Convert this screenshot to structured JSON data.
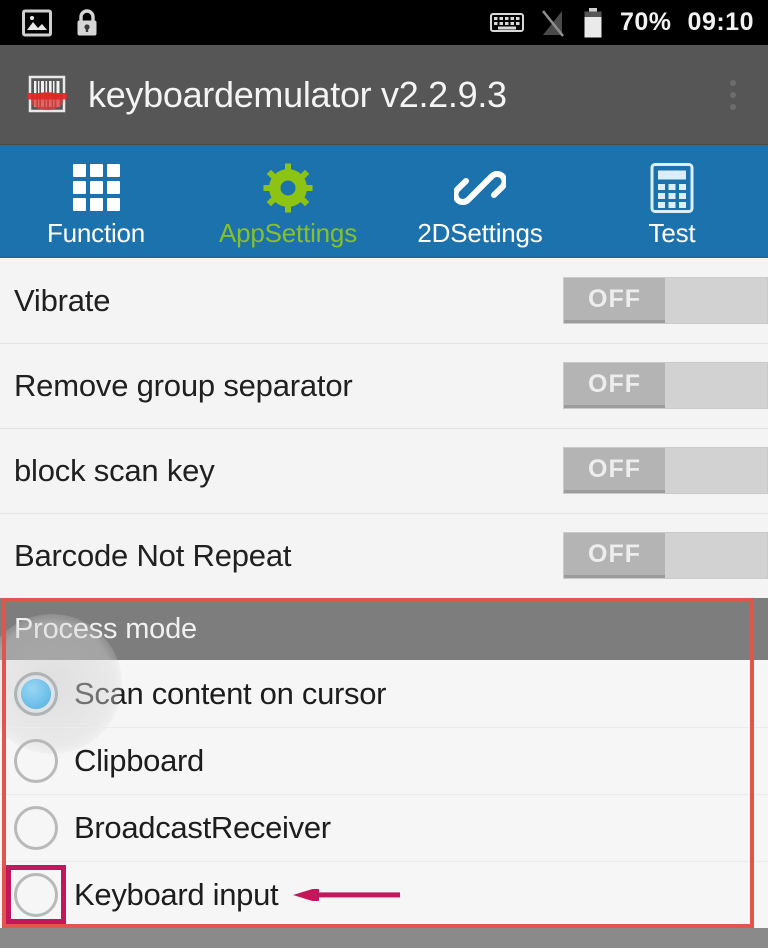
{
  "statusbar": {
    "icons_left": [
      "image-icon",
      "lock-icon"
    ],
    "icons_right": [
      "keyboard-icon",
      "signal-off-icon",
      "battery-icon"
    ],
    "battery_percent": "70%",
    "clock": "09:10"
  },
  "titlebar": {
    "app_icon": "barcode-icon",
    "title": "keyboardemulator v2.2.9.3",
    "overflow_menu": "overflow-menu-icon",
    "background": "#565656"
  },
  "tabs": {
    "accent": "#1b72ad",
    "active_color": "#86c02a",
    "items": [
      {
        "label": "Function",
        "icon": "grid-icon",
        "active": false
      },
      {
        "label": "AppSettings",
        "icon": "gear-icon",
        "active": true
      },
      {
        "label": "2DSettings",
        "icon": "link-icon",
        "active": false
      },
      {
        "label": "Test",
        "icon": "calculator-icon",
        "active": false
      }
    ]
  },
  "settings": {
    "rows": [
      {
        "label": "Vibrate",
        "switch_label": "OFF",
        "state": "off"
      },
      {
        "label": "Remove group separator",
        "switch_label": "OFF",
        "state": "off"
      },
      {
        "label": "block scan key",
        "switch_label": "OFF",
        "state": "off"
      },
      {
        "label": "Barcode Not Repeat",
        "switch_label": "OFF",
        "state": "off"
      }
    ]
  },
  "process_mode": {
    "header": "Process mode",
    "options": [
      {
        "label": "Scan content on cursor",
        "selected": true
      },
      {
        "label": "Clipboard",
        "selected": false
      },
      {
        "label": "BroadcastReceiver",
        "selected": false
      },
      {
        "label": "Keyboard input",
        "selected": false
      }
    ]
  },
  "annotations": {
    "section_box_color": "#e2554e",
    "highlight_box_color": "#c2185b",
    "arrow_color": "#c2185b",
    "arrow_target": "Keyboard input"
  }
}
